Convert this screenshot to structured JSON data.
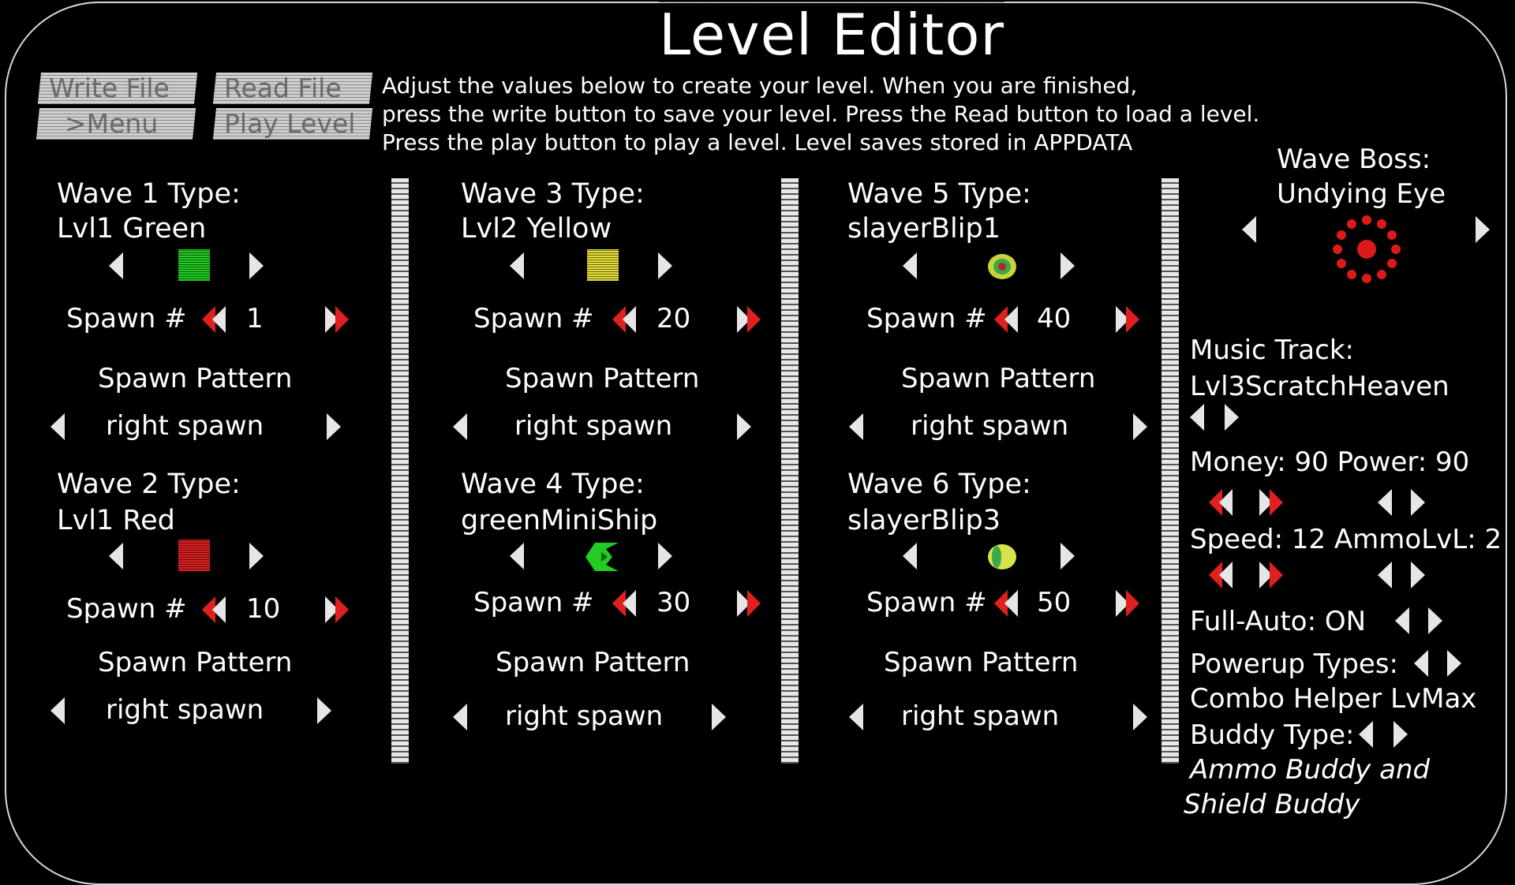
{
  "title": "Level Editor",
  "buttons": {
    "write_file": "Write File",
    "read_file": "Read File",
    "menu": ">Menu",
    "play_level": "Play Level"
  },
  "instructions": [
    "Adjust the values below to create your level. When you are finished,",
    "press the write button to save your level. Press the Read button to load a level.",
    "Press the play button to play a level. Level saves stored in APPDATA"
  ],
  "waves": [
    {
      "label": "Wave 1 Type:",
      "type": "Lvl1 Green",
      "spawn_label": "Spawn #",
      "spawn_count": "1",
      "pattern_label": "Spawn Pattern",
      "pattern": "right spawn",
      "icon": "green-square",
      "color": "#22cc22"
    },
    {
      "label": "Wave 2 Type:",
      "type": "Lvl1 Red",
      "spawn_label": "Spawn #",
      "spawn_count": "10",
      "pattern_label": "Spawn Pattern",
      "pattern": "right spawn",
      "icon": "red-square",
      "color": "#dd2020"
    },
    {
      "label": "Wave 3 Type:",
      "type": "Lvl2 Yellow",
      "spawn_label": "Spawn #",
      "spawn_count": "20",
      "pattern_label": "Spawn Pattern",
      "pattern": "right spawn",
      "icon": "yellow-square",
      "color": "#e6e03a"
    },
    {
      "label": "Wave 4 Type:",
      "type": "greenMiniShip",
      "spawn_label": "Spawn #",
      "spawn_count": "30",
      "pattern_label": "Spawn Pattern",
      "pattern": "right spawn",
      "icon": "green-ship",
      "color": "#22cc22"
    },
    {
      "label": "Wave 5 Type:",
      "type": "slayerBlip1",
      "spawn_label": "Spawn #",
      "spawn_count": "40",
      "pattern_label": "Spawn Pattern",
      "pattern": "right spawn",
      "icon": "blip-ring",
      "color": "#c8d43a"
    },
    {
      "label": "Wave 6 Type:",
      "type": "slayerBlip3",
      "spawn_label": "Spawn #",
      "spawn_count": "50",
      "pattern_label": "Spawn Pattern",
      "pattern": "right spawn",
      "icon": "blip-dot",
      "color": "#d8e24a"
    }
  ],
  "boss": {
    "label": "Wave Boss:",
    "name": "Undying Eye",
    "icon": "eye-ring",
    "color": "#dd1a1a"
  },
  "music": {
    "label": "Music Track:",
    "value": "Lvl3ScratchHeaven"
  },
  "stats": {
    "money_power": "Money: 90 Power: 90",
    "speed_ammo": "Speed: 12  AmmoLvL: 2",
    "full_auto": "Full-Auto: ON",
    "powerup_label": "Powerup Types:",
    "powerup_value": "Combo Helper LvMax",
    "buddy_label": "Buddy Type:",
    "buddy_value_1": "Ammo Buddy and",
    "buddy_value_2": "Shield Buddy"
  },
  "colors": {
    "accent_red": "#e02020",
    "arrow": "#e6e6e6",
    "button_bg": "#c8c8c8"
  }
}
